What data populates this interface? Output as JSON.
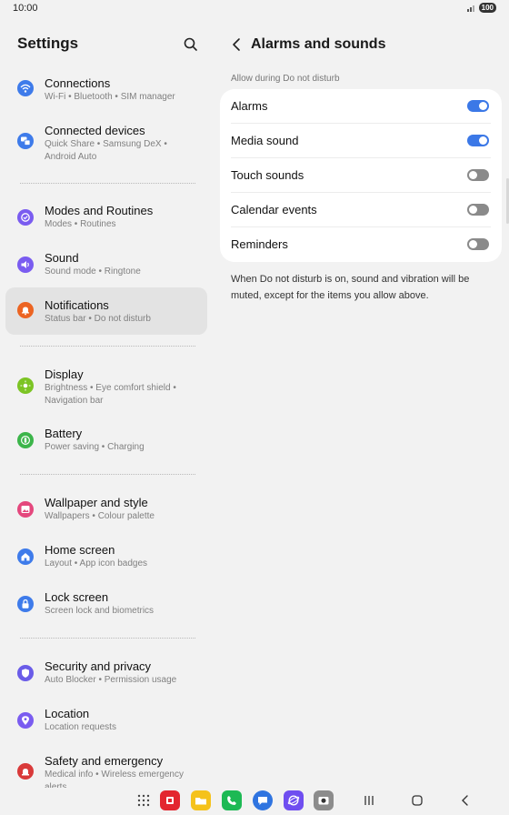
{
  "status": {
    "time": "10:00",
    "battery": "100"
  },
  "left": {
    "title": "Settings",
    "items": [
      {
        "title": "Connections",
        "sub": "Wi-Fi  •  Bluetooth  •  SIM manager",
        "icon": "wifi-icon",
        "color": "#3e7bea"
      },
      {
        "title": "Connected devices",
        "sub": "Quick Share  •  Samsung DeX  •  Android Auto",
        "icon": "devices-icon",
        "color": "#3e7bea"
      },
      {
        "title": "Modes and Routines",
        "sub": "Modes  •  Routines",
        "icon": "routine-icon",
        "color": "#7a5cf0"
      },
      {
        "title": "Sound",
        "sub": "Sound mode  •  Ringtone",
        "icon": "sound-icon",
        "color": "#7a5cf0"
      },
      {
        "title": "Notifications",
        "sub": "Status bar  •  Do not disturb",
        "icon": "bell-icon",
        "color": "#ec6422"
      },
      {
        "title": "Display",
        "sub": "Brightness  •  Eye comfort shield  •  Navigation bar",
        "icon": "sun-icon",
        "color": "#7cc424"
      },
      {
        "title": "Battery",
        "sub": "Power saving  •  Charging",
        "icon": "battery-icon",
        "color": "#3cb54a"
      },
      {
        "title": "Wallpaper and style",
        "sub": "Wallpapers  •  Colour palette",
        "icon": "wallpaper-icon",
        "color": "#e4477d"
      },
      {
        "title": "Home screen",
        "sub": "Layout  •  App icon badges",
        "icon": "home-icon",
        "color": "#3e7bea"
      },
      {
        "title": "Lock screen",
        "sub": "Screen lock and biometrics",
        "icon": "lock-icon",
        "color": "#3e7bea"
      },
      {
        "title": "Security and privacy",
        "sub": "Auto Blocker  •  Permission usage",
        "icon": "shield-icon",
        "color": "#6a5ce8"
      },
      {
        "title": "Location",
        "sub": "Location requests",
        "icon": "location-icon",
        "color": "#7a5cf0"
      },
      {
        "title": "Safety and emergency",
        "sub": "Medical info  •  Wireless emergency alerts",
        "icon": "emergency-icon",
        "color": "#d93a3a"
      }
    ]
  },
  "right": {
    "title": "Alarms and sounds",
    "section": "Allow during Do not disturb",
    "rows": [
      {
        "label": "Alarms",
        "on": true
      },
      {
        "label": "Media sound",
        "on": true
      },
      {
        "label": "Touch sounds",
        "on": false
      },
      {
        "label": "Calendar events",
        "on": false
      },
      {
        "label": "Reminders",
        "on": false
      }
    ],
    "footnote": "When Do not disturb is on, sound and vibration will be muted, except for the items you allow above."
  },
  "taskbar": {
    "apps": [
      {
        "name": "apps-grid-icon",
        "color": ""
      },
      {
        "name": "flipboard-icon",
        "color": "#e3262f"
      },
      {
        "name": "folder-icon",
        "color": "#f5c21b"
      },
      {
        "name": "phone-icon",
        "color": "#1db954"
      },
      {
        "name": "messages-icon",
        "color": "#2f74e0"
      },
      {
        "name": "internet-icon",
        "color": "#6f4ef0"
      },
      {
        "name": "camera-icon",
        "color": "#8c8c8c"
      }
    ]
  }
}
